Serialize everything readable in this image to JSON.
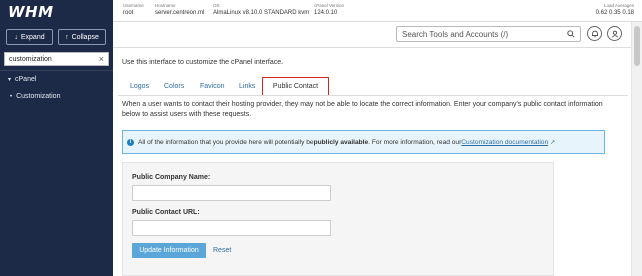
{
  "sidebar": {
    "logo": "WHM",
    "expand_label": "Expand",
    "collapse_label": "Collapse",
    "search_value": "customization",
    "close_glyph": "×",
    "items": [
      {
        "label": "cPanel",
        "icon": "caret-down-icon"
      },
      {
        "label": "Customization",
        "icon": "bullet-icon"
      }
    ]
  },
  "topbar": {
    "username_label": "Username",
    "username": "root",
    "hostname_label": "Hostname",
    "hostname": "server.centreon.ml",
    "os_label": "OS",
    "os": "AlmaLinux v8.10.0 STANDARD kvm",
    "cpanel_label": "cPanel Version",
    "cpanel_version": "124.0.10",
    "load_label": "Load Averages",
    "load": "0.62  0.35  0.18"
  },
  "search": {
    "placeholder": "Search Tools and Accounts (/)"
  },
  "main": {
    "intro": "Use this interface to customize the cPanel interface.",
    "tabs": [
      "Logos",
      "Colors",
      "Favicon",
      "Links",
      "Public Contact"
    ],
    "active_tab": "Public Contact",
    "description": "When a user wants to contact their hosting provider, they may not be able to locate the correct information. Enter your company's public contact information below to assist users with these requests.",
    "alert_text_1": "All of the information that you provide here will potentially be ",
    "alert_bold": "publicly available",
    "alert_text_2": ". For more information, read our ",
    "alert_link": "Customization documentation",
    "company_label": "Public Company Name:",
    "company_value": "",
    "url_label": "Public Contact URL:",
    "url_value": "",
    "update_label": "Update Information",
    "reset_label": "Reset"
  },
  "colors": {
    "sidebar_bg": "#1c2a48",
    "link": "#2d6da3",
    "active_tab_highlight": "#d9231d",
    "alert_bg": "#e8f4fb",
    "primary_button": "#5ba6d8"
  }
}
